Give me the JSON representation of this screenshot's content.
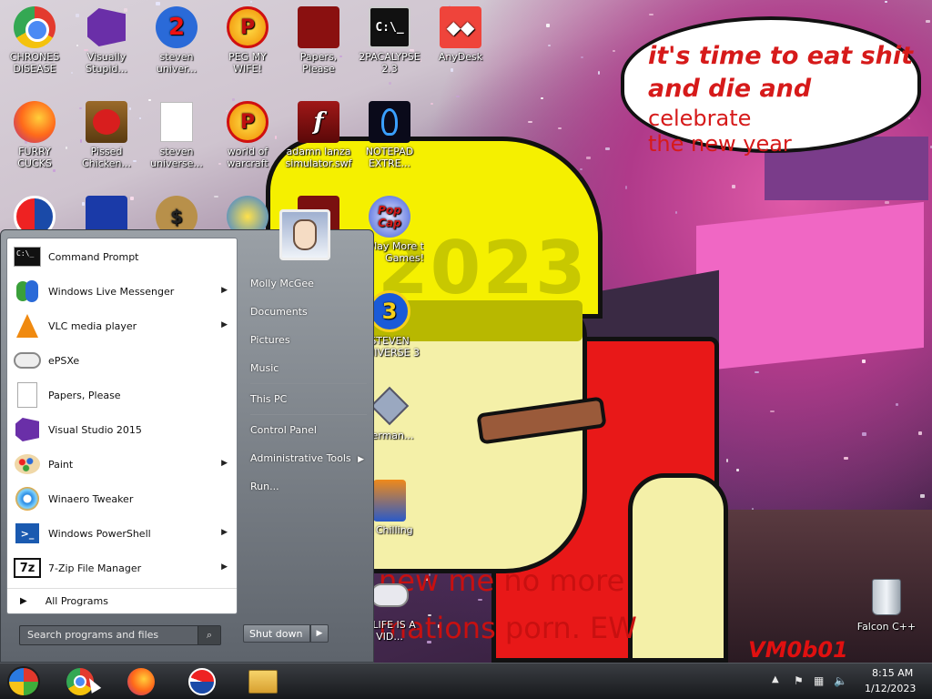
{
  "desktop": {
    "icons": [
      {
        "label": "CHRONES DISEASE",
        "icon": "chrome-icon"
      },
      {
        "label": "Visually Stupid...",
        "icon": "visual-studio-icon"
      },
      {
        "label": "steven univer...",
        "icon": "steven-universe-icon"
      },
      {
        "label": "PEG MY WIFE!",
        "icon": "peggle-icon"
      },
      {
        "label": "Papers, Please",
        "icon": "papers-please-icon"
      },
      {
        "label": "2PACALYPSE 2.3",
        "icon": "console-icon"
      },
      {
        "label": "AnyDesk",
        "icon": "anydesk-icon"
      },
      {
        "label": "FURRY CUCKS",
        "icon": "firefox-icon"
      },
      {
        "label": "Pissed Chicken...",
        "icon": "angry-birds-icon"
      },
      {
        "label": "steven universe...",
        "icon": "blank-file-icon"
      },
      {
        "label": "world of warcraft",
        "icon": "peggle-icon"
      },
      {
        "label": "adamn lanza simulator.swf",
        "icon": "flash-icon"
      },
      {
        "label": "NOTEPAD EXTRE...",
        "icon": "notepad-extreme-icon"
      },
      {
        "label": "Play More t Games!",
        "icon": "popcap-icon"
      },
      {
        "label": "STEVEN UNIVERSE 3",
        "icon": "steven-universe-3-icon"
      },
      {
        "label": "derman...",
        "icon": "diamond-icon"
      },
      {
        "label": "g Chilling",
        "icon": "game-box-icon"
      },
      {
        "label": "Y LIFE IS A VID...",
        "icon": "gamepad-icon"
      },
      {
        "label": "Falcon C++",
        "icon": "recycle-bin-icon"
      }
    ],
    "wallpaper": {
      "bubble_strong": "it's time to eat shit",
      "bubble_strong2": "and die and",
      "bubble_soft": "celebrate",
      "bubble_soft2": "the new year",
      "year": "2023",
      "bottom_text": "new me no more mations porn. EW YEAR!",
      "watermark": "VM0b01"
    }
  },
  "start_menu": {
    "programs": [
      {
        "label": "Command Prompt",
        "submenu": false
      },
      {
        "label": "Windows Live Messenger",
        "submenu": true
      },
      {
        "label": "VLC media player",
        "submenu": true
      },
      {
        "label": "ePSXe",
        "submenu": false
      },
      {
        "label": "Papers, Please",
        "submenu": false
      },
      {
        "label": "Visual Studio 2015",
        "submenu": false
      },
      {
        "label": "Paint",
        "submenu": true
      },
      {
        "label": "Winaero Tweaker",
        "submenu": false
      },
      {
        "label": "Windows PowerShell",
        "submenu": true
      },
      {
        "label": "7-Zip File Manager",
        "submenu": true
      }
    ],
    "all_programs": "All Programs",
    "search_placeholder": "Search programs and files",
    "right_items": {
      "user": "Molly McGee",
      "documents": "Documents",
      "pictures": "Pictures",
      "music": "Music",
      "this_pc": "This PC",
      "control_panel": "Control Panel",
      "admin_tools": "Administrative Tools",
      "run": "Run..."
    },
    "shutdown": "Shut down"
  },
  "taskbar": {
    "pinned": [
      "chrome-icon",
      "firefox-icon",
      "obama-icon",
      "file-explorer-icon"
    ],
    "time": "8:15 AM",
    "date": "1/12/2023"
  }
}
